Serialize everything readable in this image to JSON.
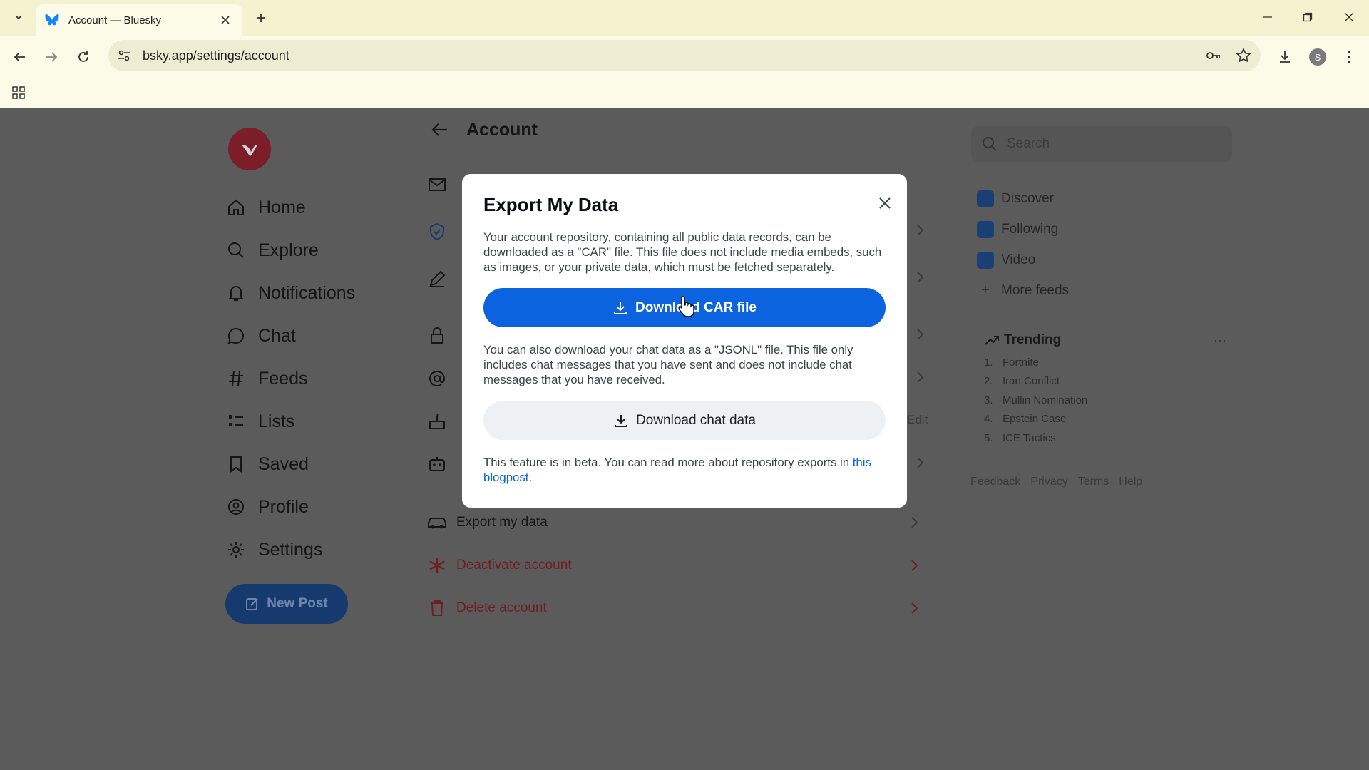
{
  "browser": {
    "tab_title": "Account — Bluesky",
    "url": "bsky.app/settings/account",
    "profile_initial": "S"
  },
  "sidebar": {
    "items": [
      {
        "label": "Home",
        "icon": "home-icon"
      },
      {
        "label": "Explore",
        "icon": "search-icon"
      },
      {
        "label": "Notifications",
        "icon": "bell-icon"
      },
      {
        "label": "Chat",
        "icon": "chat-icon"
      },
      {
        "label": "Feeds",
        "icon": "hash-icon"
      },
      {
        "label": "Lists",
        "icon": "list-icon"
      },
      {
        "label": "Saved",
        "icon": "bookmark-icon"
      },
      {
        "label": "Profile",
        "icon": "user-circle-icon"
      },
      {
        "label": "Settings",
        "icon": "gear-icon"
      }
    ],
    "new_post_label": "New Post"
  },
  "page": {
    "title": "Account",
    "rows": [
      {
        "label": "Export my data",
        "icon": "car-icon"
      },
      {
        "label": "Deactivate account",
        "icon": "snowflake-icon"
      },
      {
        "label": "Delete account",
        "icon": "trash-icon"
      }
    ],
    "edit_label": "Edit"
  },
  "right_panel": {
    "search_placeholder": "Search",
    "feeds": [
      "Discover",
      "Following",
      "Video"
    ],
    "more_feeds": "More feeds",
    "trending_title": "Trending",
    "trending_more": "···",
    "trending": [
      {
        "n": "1.",
        "label": "Fortnite"
      },
      {
        "n": "2.",
        "label": "Iran Conflict"
      },
      {
        "n": "3.",
        "label": "Mullin Nomination"
      },
      {
        "n": "4.",
        "label": "Epstein Case"
      },
      {
        "n": "5.",
        "label": "ICE Tactics"
      }
    ],
    "footer": [
      "Feedback",
      "Privacy",
      "Terms",
      "Help"
    ]
  },
  "modal": {
    "title": "Export My Data",
    "intro": "Your account repository, containing all public data records, can be downloaded as a \"CAR\" file. This file does not include media embeds, such as images, or your private data, which must be fetched separately.",
    "download_car_label": "Download CAR file",
    "chat_text": "You can also download your chat data as a \"JSONL\" file. This file only includes chat messages that you have sent and does not include chat messages that you have received.",
    "download_chat_label": "Download chat data",
    "beta_text": "This feature is in beta. You can read more about repository exports in",
    "blog_link": "this blogpost",
    "blog_suffix": "."
  },
  "colors": {
    "primary": "#0b63e0",
    "danger": "#6e1d22",
    "overlay": "#5b5b5b"
  }
}
